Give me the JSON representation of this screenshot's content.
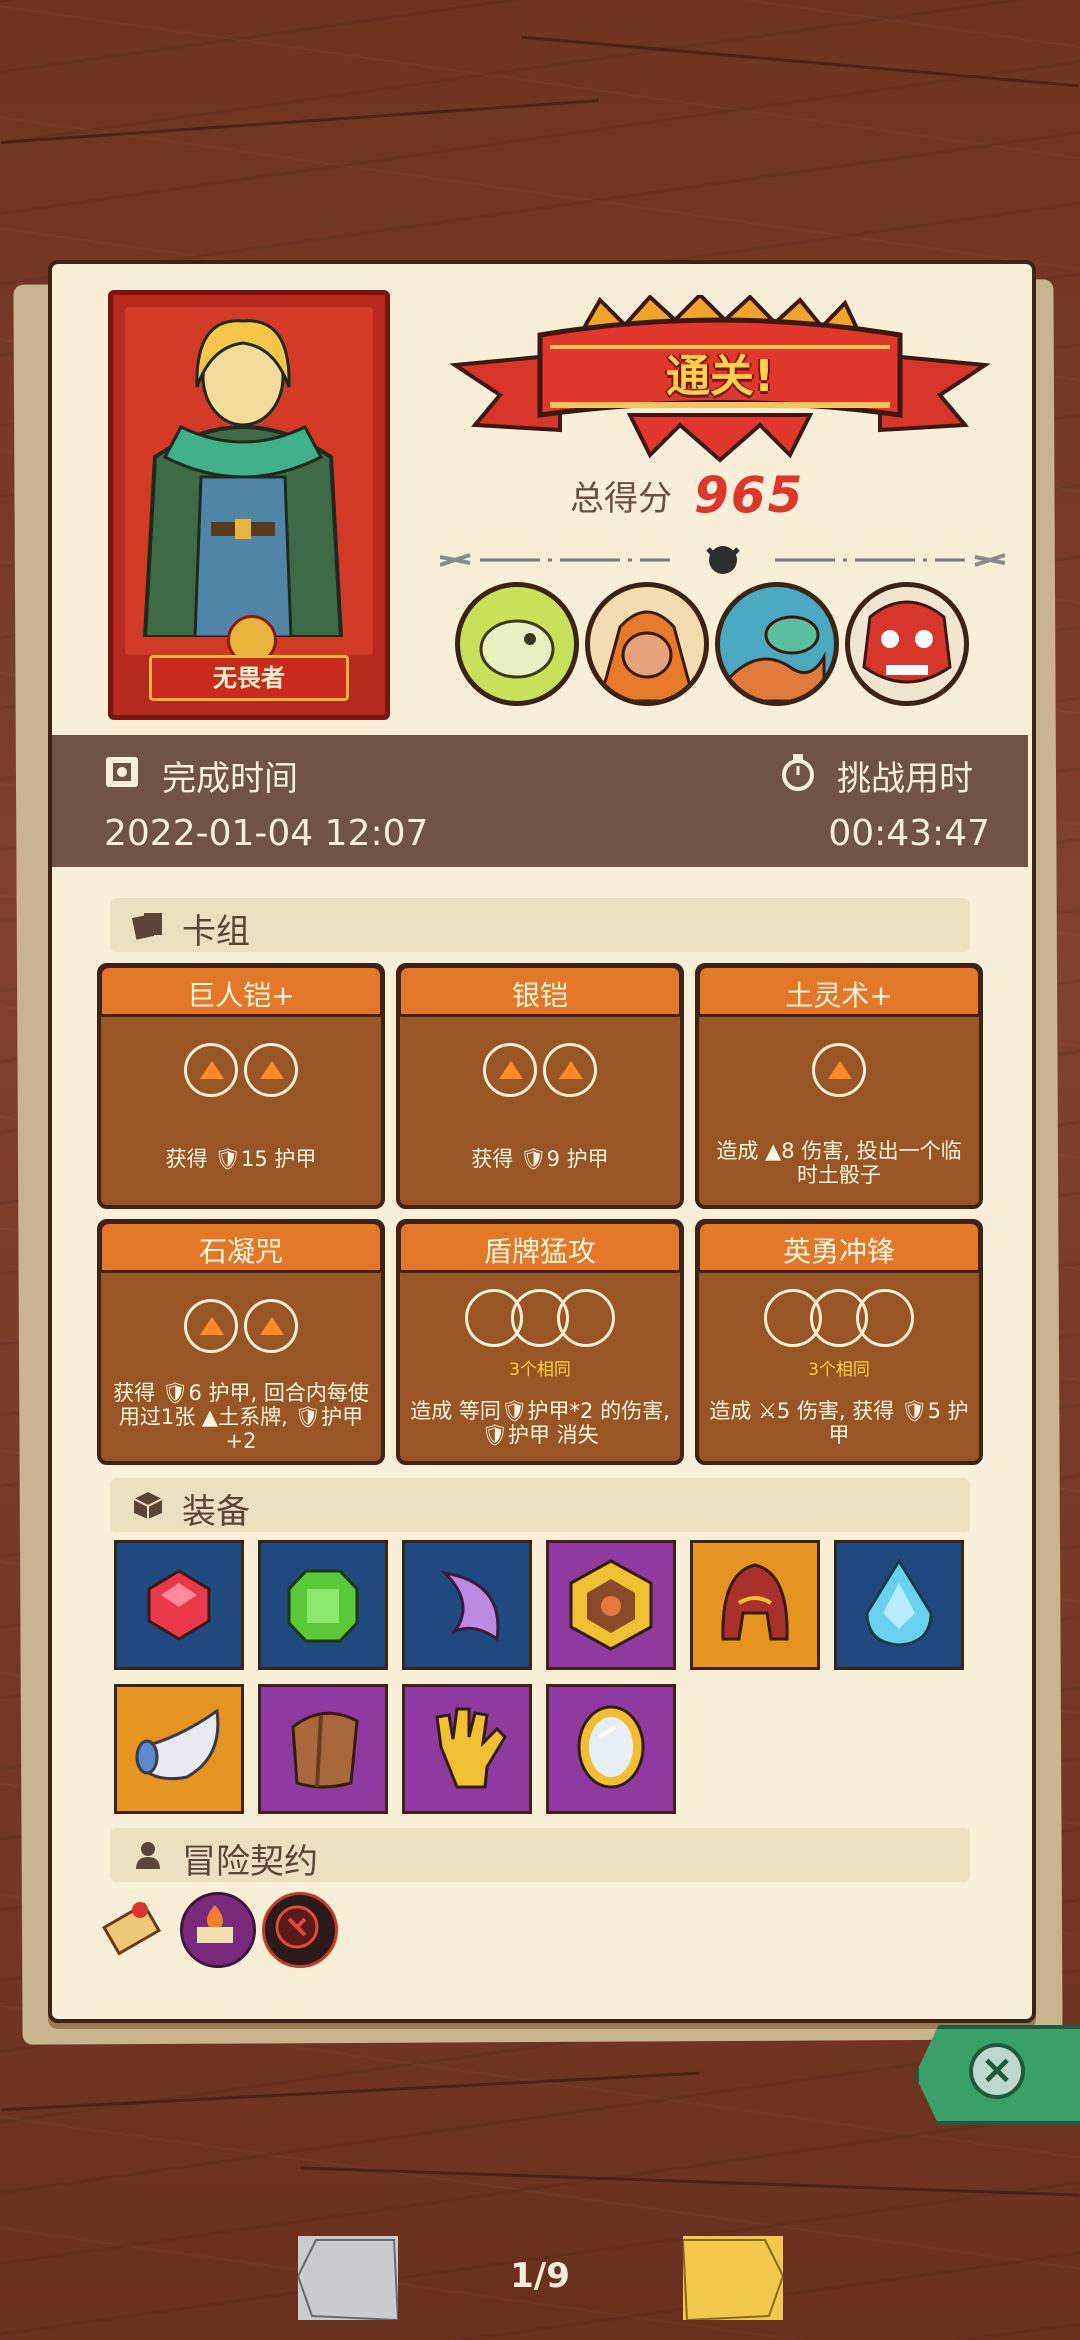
{
  "hero": {
    "name": "无畏者"
  },
  "result": {
    "banner": "通关!",
    "score_label": "总得分",
    "score_value": "965"
  },
  "info": {
    "finish_time_label": "完成时间",
    "finish_time_value": "2022-01-04 12:07",
    "challenge_time_label": "挑战用时",
    "challenge_time_value": "00:43:47"
  },
  "deck": {
    "title": "卡组",
    "cards": [
      {
        "name": "巨人铠+",
        "desc": "获得 🛡15 护甲",
        "costs": 2,
        "same": ""
      },
      {
        "name": "银铠",
        "desc": "获得 🛡9 护甲",
        "costs": 2,
        "same": ""
      },
      {
        "name": "土灵术+",
        "desc": "造成 ▲8 伤害, 投出一个临时土骰子",
        "costs": 1,
        "same": ""
      },
      {
        "name": "石凝咒",
        "desc": "获得 🛡6 护甲, 回合内每使用过1张 ▲土系牌, 🛡护甲+2",
        "costs": 2,
        "same": ""
      },
      {
        "name": "盾牌猛攻",
        "desc": "造成 等同🛡护甲*2 的伤害, 🛡护甲 消失",
        "costs": 0,
        "same": "3个相同"
      },
      {
        "name": "英勇冲锋",
        "desc": "造成 ⚔5 伤害, 获得 🛡5 护甲",
        "costs": 0,
        "same": "3个相同"
      }
    ]
  },
  "equipment": {
    "title": "装备",
    "items": [
      {
        "icon": "red-gem-icon",
        "color": "#1f4a80"
      },
      {
        "icon": "green-gem-icon",
        "color": "#1f4a80"
      },
      {
        "icon": "purple-crescent-icon",
        "color": "#1f4a80"
      },
      {
        "icon": "hex-amulet-icon",
        "color": "#8e3aa0"
      },
      {
        "icon": "red-helmet-icon",
        "color": "#e59420"
      },
      {
        "icon": "blue-drop-gem-icon",
        "color": "#1f4a80"
      },
      {
        "icon": "horn-icon",
        "color": "#e59420"
      },
      {
        "icon": "leather-armor-icon",
        "color": "#8e3aa0"
      },
      {
        "icon": "golden-glove-icon",
        "color": "#8e3aa0"
      },
      {
        "icon": "mirror-icon",
        "color": "#8e3aa0"
      }
    ]
  },
  "contract": {
    "title": "冒险契约",
    "items": [
      "scroll-icon",
      "fire-book-icon",
      "dark-rune-icon"
    ]
  },
  "nav": {
    "page": "1/9"
  }
}
